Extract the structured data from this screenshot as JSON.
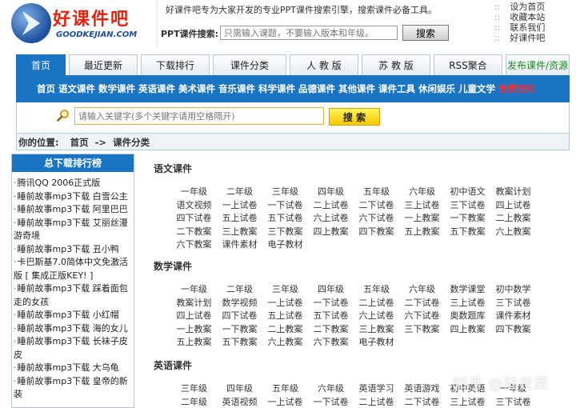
{
  "logo": {
    "cn": "好课件吧",
    "en": "GOODKEJIAN.COM"
  },
  "header": {
    "slogan": "好课件吧专为大家开发的专业PPT课件搜索引擎，搜索课件必备工具。",
    "search_label": "PPT课件搜索:",
    "search_placeholder": "只需输入课题，不要输入版本和年级。",
    "search_button": "搜索"
  },
  "quick_links": [
    "设为首页",
    "收藏本站",
    "联系我们",
    "好课件吧"
  ],
  "nav_tabs": [
    "首页",
    "最近更新",
    "下载排行",
    "课件分类",
    "人 教 版",
    "苏 教 版",
    "RSS聚合",
    "发布课件/资源"
  ],
  "category_links": [
    "首页",
    "语文课件",
    "数学课件",
    "英语课件",
    "美术课件",
    "音乐课件",
    "科学课件",
    "品德课件",
    "其他课件",
    "课件工具",
    "休闲娱乐",
    "儿童文学",
    "免费空间"
  ],
  "main_search": {
    "placeholder": "请输入关键字(多个关键字请用空格隔开)",
    "button": "搜 索"
  },
  "breadcrumb": {
    "label": "你的位置:",
    "home": "首页",
    "sep": "->",
    "current": "课件分类"
  },
  "sidebar": {
    "title": "总下载排行榜",
    "items": [
      "腾讯QQ 2006正式版",
      "睡前故事mp3下载 白雪公主",
      "睡前故事mp3下载 阿里巴巴",
      "睡前故事mp3下载 艾丽丝漫游奇境",
      "睡前故事mp3下载 丑小鸭",
      "卡巴斯基7.0简体中文免激活版 [ 集成正版KEY! ]",
      "睡前故事mp3下载 踩着面包走的女孩",
      "睡前故事mp3下载 小红帽",
      "睡前故事mp3下载 海的女儿",
      "睡前故事mp3下载 长袜子皮皮",
      "睡前故事mp3下载 大乌龟",
      "睡前故事mp3下载 皇帝的新装"
    ]
  },
  "sections": [
    {
      "title": "语文课件",
      "rows": [
        [
          "一年级",
          "二年级",
          "三年级",
          "四年级",
          "五年级",
          "六年级",
          "初中语文",
          "教案计划"
        ],
        [
          "语文视频",
          "一上试卷",
          "一下试卷",
          "二上试卷",
          "二下试卷",
          "三上试卷",
          "三下试卷",
          "四上试卷"
        ],
        [
          "四下试卷",
          "五上试卷",
          "五下试卷",
          "六上试卷",
          "六下试卷",
          "一上教案",
          "一下教案",
          "二上教案"
        ],
        [
          "二下教案",
          "三上教案",
          "三下教案",
          "四上教案",
          "四下教案",
          "五上教案",
          "五下教案",
          "六上教案"
        ],
        [
          "六下教案",
          "课件素材",
          "电子教材"
        ]
      ]
    },
    {
      "title": "数学课件",
      "rows": [
        [
          "一年级",
          "二年级",
          "三年级",
          "四年级",
          "五年级",
          "六年级",
          "数学课堂",
          "初中数学"
        ],
        [
          "教案计划",
          "数学视频",
          "一上试卷",
          "一下试卷",
          "二上试卷",
          "二下试卷",
          "三上试卷",
          "三下试卷"
        ],
        [
          "四上试卷",
          "四下试卷",
          "五上试卷",
          "五下试卷",
          "六上试卷",
          "六下试卷",
          "奥数题库",
          "课件素材"
        ],
        [
          "一上教案",
          "一下教案",
          "二上教案",
          "二下教案",
          "三上教案",
          "三下教案",
          "四上教案",
          "四下教案"
        ],
        [
          "五上教案",
          "五下教案",
          "六上教案",
          "六下教案",
          "电子教材"
        ]
      ]
    },
    {
      "title": "英语课件",
      "rows": [
        [
          "三年级",
          "四年级",
          "五年级",
          "六年级",
          "英语学习",
          "英语游戏",
          "初中英语",
          "一年级"
        ],
        [
          "二年级",
          "英语视频",
          "一上试卷",
          "一下试卷",
          "二上试卷",
          "二下试卷",
          "三上试卷",
          "三下试卷"
        ]
      ]
    }
  ],
  "watermark": "知乎 @陆世民",
  "colors": {
    "brand_blue": "#1a74c4",
    "logo_red": "#e6220e",
    "search_yellow": "#f7c800"
  }
}
